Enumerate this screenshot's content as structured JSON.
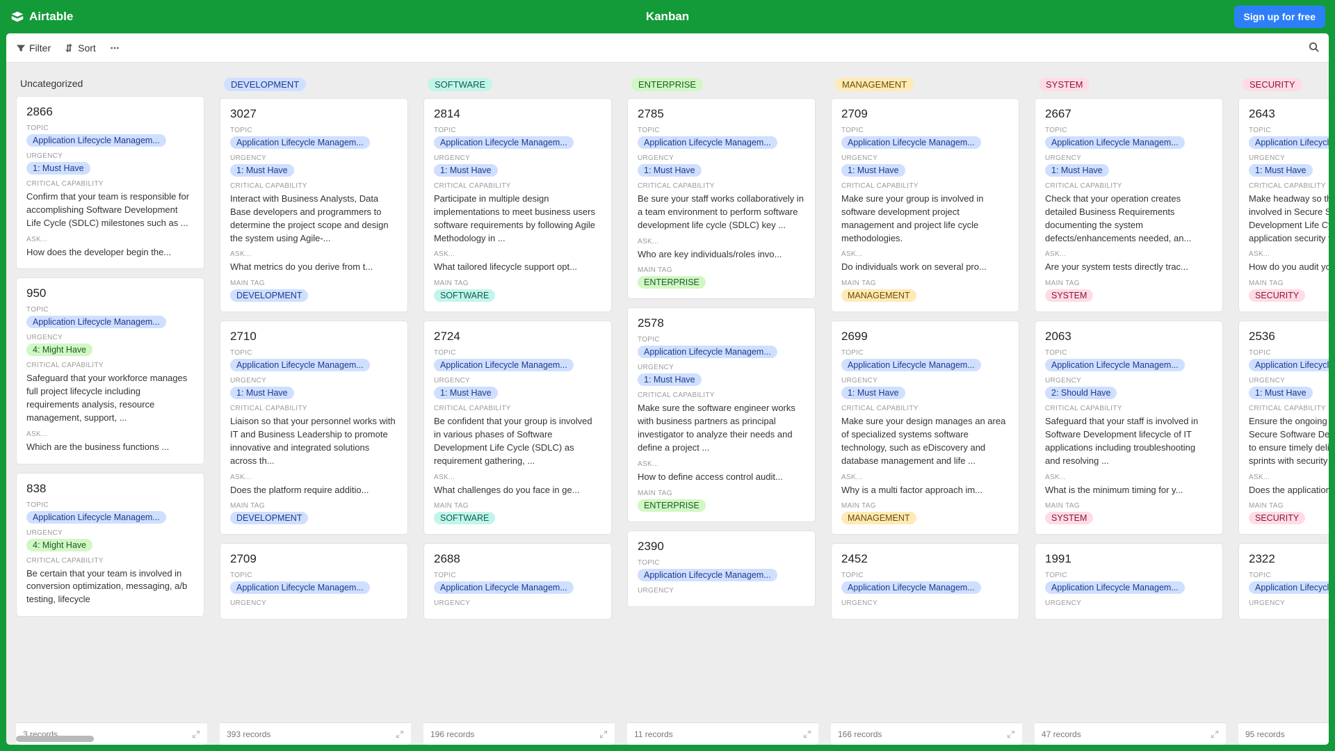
{
  "header": {
    "brand": "Airtable",
    "title": "Kanban",
    "signup": "Sign up for free"
  },
  "toolbar": {
    "filter": "Filter",
    "sort": "Sort"
  },
  "labels": {
    "topic": "TOPIC",
    "urgency": "URGENCY",
    "cap": "CRITICAL CAPABILITY",
    "ask": "ASK...",
    "tag": "MAIN TAG"
  },
  "topic_pill": "Application Lifecycle Managem...",
  "urg_must": "1: Must Have",
  "urg_might": "4: Might Have",
  "urg_should": "2: Should Have",
  "columns": [
    {
      "title": "Uncategorized",
      "pill": null,
      "records": "3 records",
      "cards": [
        {
          "id": "2866",
          "urg": "must",
          "cap": "Confirm that your team is responsible for accomplishing Software Development Life Cycle (SDLC) milestones such as ...",
          "ask": "How does the developer begin the...",
          "tag": null
        },
        {
          "id": "950",
          "urg": "might",
          "cap": "Safeguard that your workforce manages full project lifecycle including requirements analysis, resource management, support, ...",
          "ask": "Which are the business functions ...",
          "tag": null
        },
        {
          "id": "838",
          "urg": "might",
          "cap": "Be certain that your team is involved in conversion optimization, messaging, a/b testing, lifecycle",
          "ask": "",
          "tag": null
        }
      ]
    },
    {
      "title": "DEVELOPMENT",
      "pill": "c-blue",
      "records": "393 records",
      "cards": [
        {
          "id": "3027",
          "urg": "must",
          "cap": "Interact with Business Analysts, Data Base developers and programmers to determine the project scope and design the system using Agile-...",
          "ask": "What metrics do you derive from t...",
          "tag": "DEVELOPMENT",
          "tagc": "c-blue"
        },
        {
          "id": "2710",
          "urg": "must",
          "cap": "Liaison so that your personnel works with IT and Business Leadership to promote innovative and integrated solutions across th...",
          "ask": "Does the platform require additio...",
          "tag": "DEVELOPMENT",
          "tagc": "c-blue"
        },
        {
          "id": "2709",
          "urg": "",
          "cap": "",
          "ask": "",
          "tag": null
        }
      ]
    },
    {
      "title": "SOFTWARE",
      "pill": "c-teal",
      "records": "196 records",
      "cards": [
        {
          "id": "2814",
          "urg": "must",
          "cap": "Participate in multiple design implementations to meet business users software requirements by following Agile Methodology in ...",
          "ask": "What tailored lifecycle support opt...",
          "tag": "SOFTWARE",
          "tagc": "c-teal"
        },
        {
          "id": "2724",
          "urg": "must",
          "cap": "Be confident that your group is involved in various phases of Software Development Life Cycle (SDLC) as requirement gathering, ...",
          "ask": "What challenges do you face in ge...",
          "tag": "SOFTWARE",
          "tagc": "c-teal"
        },
        {
          "id": "2688",
          "urg": "",
          "cap": "",
          "ask": "",
          "tag": null
        }
      ]
    },
    {
      "title": "ENTERPRISE",
      "pill": "c-green",
      "records": "11 records",
      "cards": [
        {
          "id": "2785",
          "urg": "must",
          "cap": "Be sure your staff works collaboratively in a team environment to perform software development life cycle (SDLC) key ...",
          "ask": "Who are key individuals/roles invo...",
          "tag": "ENTERPRISE",
          "tagc": "c-green"
        },
        {
          "id": "2578",
          "urg": "must",
          "cap": "Make sure the software engineer works with business partners as principal investigator to analyze their needs and define a project ...",
          "ask": "How to define access control audit...",
          "tag": "ENTERPRISE",
          "tagc": "c-green"
        },
        {
          "id": "2390",
          "urg": "",
          "cap": "",
          "ask": "",
          "tag": null
        }
      ]
    },
    {
      "title": "MANAGEMENT",
      "pill": "c-yellow",
      "records": "166 records",
      "cards": [
        {
          "id": "2709",
          "urg": "must",
          "cap": "Make sure your group is involved in software development project management and project life cycle methodologies.",
          "ask": "Do individuals work on several pro...",
          "tag": "MANAGEMENT",
          "tagc": "c-yellow"
        },
        {
          "id": "2699",
          "urg": "must",
          "cap": "Make sure your design manages an area of specialized systems software technology, such as eDiscovery and database management and life ...",
          "ask": "Why is a multi factor approach im...",
          "tag": "MANAGEMENT",
          "tagc": "c-yellow"
        },
        {
          "id": "2452",
          "urg": "",
          "cap": "",
          "ask": "",
          "tag": null
        }
      ]
    },
    {
      "title": "SYSTEM",
      "pill": "c-pink",
      "records": "47 records",
      "cards": [
        {
          "id": "2667",
          "urg": "must",
          "cap": "Check that your operation creates detailed Business Requirements documenting the system defects/enhancements needed, an...",
          "ask": "Are your system tests directly trac...",
          "tag": "SYSTEM",
          "tagc": "c-pink"
        },
        {
          "id": "2063",
          "urg": "should",
          "cap": "Safeguard that your staff is involved in Software Development lifecycle of IT applications including troubleshooting and resolving ...",
          "ask": "What is the minimum timing for y...",
          "tag": "SYSTEM",
          "tagc": "c-pink"
        },
        {
          "id": "1991",
          "urg": "",
          "cap": "",
          "ask": "",
          "tag": null
        }
      ]
    },
    {
      "title": "SECURITY",
      "pill": "c-pink",
      "records": "95 records",
      "cards": [
        {
          "id": "2643",
          "urg": "must",
          "cap": "Make headway so that your staff is involved in Secure Software Development Life Cycle (S SDLC), application security frameworks, ...",
          "ask": "How do you audit your data throu...",
          "tag": "SECURITY",
          "tagc": "c-pink"
        },
        {
          "id": "2536",
          "urg": "must",
          "cap": "Ensure the ongoing management of a Secure Software Development Life Cycle to ensure timely delivery of application sprints with security ...",
          "ask": "Does the application security ensu...",
          "tag": "SECURITY",
          "tagc": "c-pink"
        },
        {
          "id": "2322",
          "urg": "",
          "cap": "",
          "ask": "",
          "tag": null
        }
      ]
    }
  ]
}
